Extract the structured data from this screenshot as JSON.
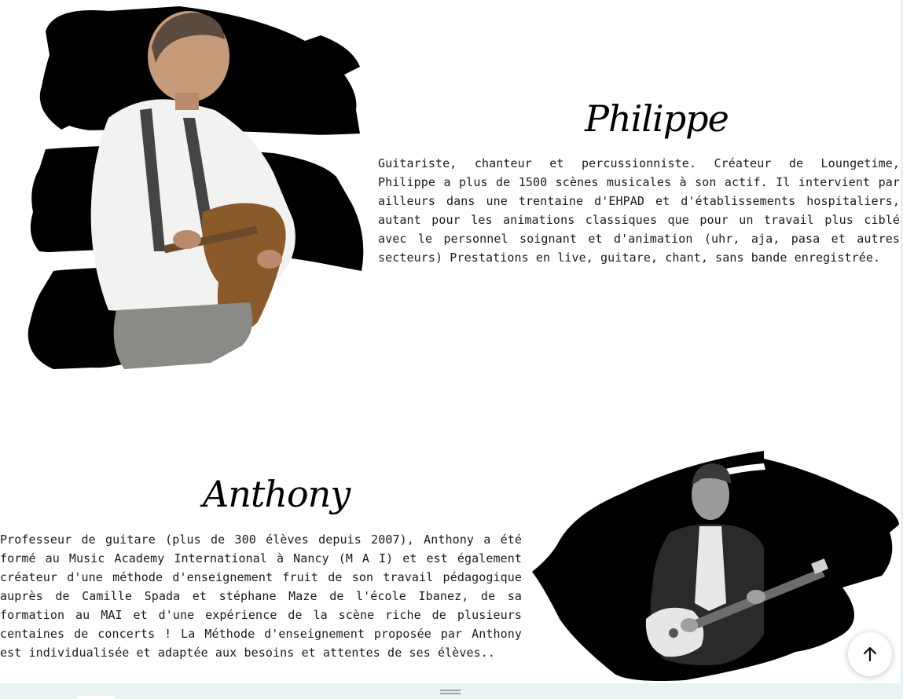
{
  "musicians": [
    {
      "name": "Philippe",
      "bio": "Guitariste, chanteur et percussionniste. Créateur de Loungetime, Philippe a plus de 1500 scènes musicales à son actif. Il intervient par ailleurs dans une trentaine d'EHPAD et d'établissements hospitaliers, autant pour les animations classiques que pour un travail plus ciblé avec le personnel soignant et d'animation (uhr, aja, pasa et autres secteurs) Prestations en live, guitare, chant, sans bande enregistrée."
    },
    {
      "name": "Anthony",
      "bio": "Professeur de guitare (plus de 300 élèves depuis 2007), Anthony a été formé au Music Academy International à Nancy (M A I) et est également créateur d'une méthode d'enseignement fruit de son travail pédagogique auprès de Camille Spada et stéphane Maze de l'école Ibanez, de sa formation au MAI et d'une expérience de la scène riche de plusieurs centaines de concerts ! La Méthode d'enseignement proposée par Anthony est individualisée et adaptée aux besoins et attentes de ses élèves.."
    }
  ],
  "icons": {
    "scroll_top": "arrow-up-icon",
    "drag_handle": "drag-handle-icon"
  },
  "colors": {
    "text": "#1a1a1a",
    "brush": "#000000",
    "bottom_bar": "#eaf3f3"
  }
}
